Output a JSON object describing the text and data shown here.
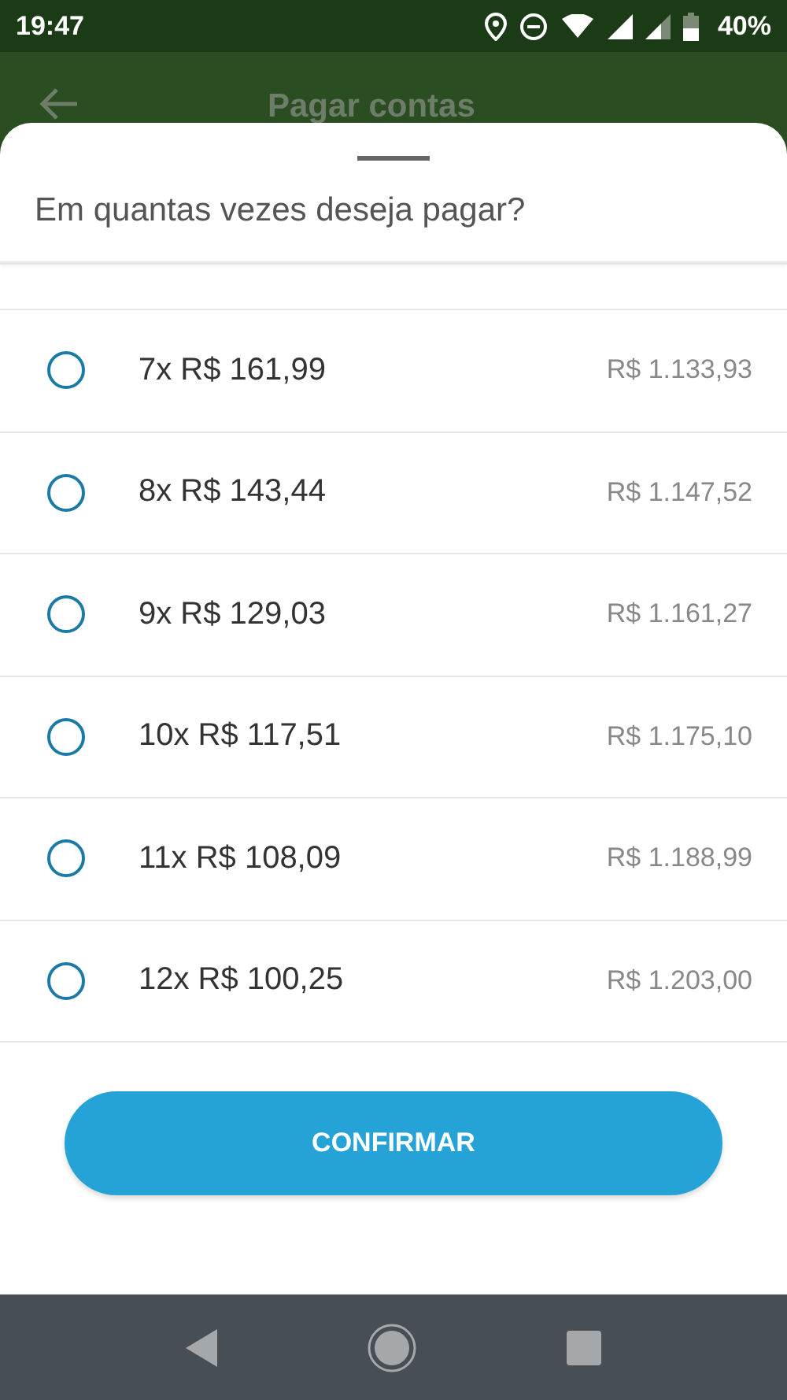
{
  "status_bar": {
    "time": "19:47",
    "battery": "40%"
  },
  "app_bar": {
    "title": "Pagar contas"
  },
  "sheet": {
    "title": "Em quantas vezes deseja pagar?",
    "options": [
      {
        "label": "7x R$ 161,99",
        "total": "R$ 1.133,93",
        "selected": false
      },
      {
        "label": "8x R$ 143,44",
        "total": "R$ 1.147,52",
        "selected": false
      },
      {
        "label": "9x R$ 129,03",
        "total": "R$ 1.161,27",
        "selected": false
      },
      {
        "label": "10x R$ 117,51",
        "total": "R$ 1.175,10",
        "selected": false
      },
      {
        "label": "11x R$ 108,09",
        "total": "R$ 1.188,99",
        "selected": false
      },
      {
        "label": "12x R$ 100,25",
        "total": "R$ 1.203,00",
        "selected": false
      }
    ],
    "button": "CONFIRMAR"
  }
}
